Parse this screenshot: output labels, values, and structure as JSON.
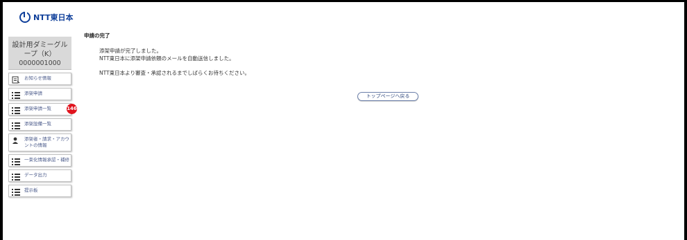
{
  "header": {
    "logo_text": "NTT東日本"
  },
  "sidebar": {
    "user": {
      "name": "設計用ダミーグループ（K）",
      "id": "0000001000"
    },
    "items": [
      {
        "label": "お知らせ情報",
        "icon": "notice-icon"
      },
      {
        "label": "添架申請",
        "icon": "list-icon"
      },
      {
        "label": "添架申請一覧",
        "icon": "list-icon",
        "badge": "146"
      },
      {
        "label": "添架設備一覧",
        "icon": "list-icon"
      },
      {
        "label": "添架者・請求・アカウントの情報",
        "icon": "person-icon"
      },
      {
        "label": "一束化情報承認・補修",
        "icon": "list-icon"
      },
      {
        "label": "データ出力",
        "icon": "list-icon"
      },
      {
        "label": "提示板",
        "icon": "list-icon"
      }
    ]
  },
  "main": {
    "title": "申請の完了",
    "messages": [
      "添架申請が完了しました。",
      "NTT東日本に添架申請依頼のメールを自動送信しました。",
      "NTT東日本より審査・承認されるまでしばらくお待ちください。"
    ],
    "top_button": "トップページへ戻る"
  }
}
